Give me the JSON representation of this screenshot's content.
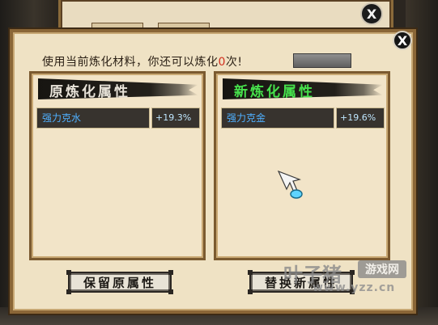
{
  "back_window": {
    "close_label": "X"
  },
  "dialog": {
    "close_label": "X",
    "info_prefix": "使用当前炼化材料，你还可以炼化",
    "remaining_count": "0",
    "info_suffix": "次!",
    "grey_button_label": ""
  },
  "left_panel": {
    "title": "原炼化属性",
    "attribute": {
      "name": "强力克水",
      "value": "+19.3%"
    }
  },
  "right_panel": {
    "title": "新炼化属性",
    "attribute": {
      "name": "强力克金",
      "value": "+19.6%"
    }
  },
  "buttons": {
    "keep_label": "保留原属性",
    "replace_label": "替换新属性"
  },
  "watermark": {
    "logo": "叶子猪",
    "badge": "游戏网",
    "url": "www.yzz.cn"
  },
  "colors": {
    "count_red": "#d12f1f",
    "new_title_green": "#47e24c",
    "attr_name_blue": "#4fb0ff"
  }
}
